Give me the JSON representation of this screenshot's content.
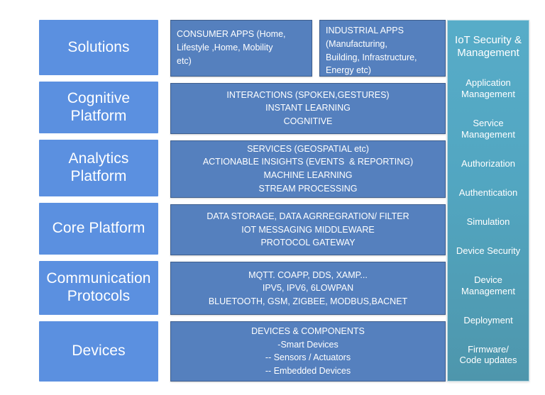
{
  "layers": [
    {
      "label": "Solutions"
    },
    {
      "label_line1": "Cognitive",
      "label_line2": "Platform"
    },
    {
      "label_line1": "Analytics",
      "label_line2": "Platform"
    },
    {
      "label": "Core Platform"
    },
    {
      "label_line1": "Communication",
      "label_line2": "Protocols"
    },
    {
      "label": "Devices"
    }
  ],
  "left_labels": {
    "solutions": "Solutions",
    "cognitive_1": "Cognitive",
    "cognitive_2": "Platform",
    "analytics_1": "Analytics",
    "analytics_2": "Platform",
    "core": "Core Platform",
    "comm_1": "Communication",
    "comm_2": "Protocols",
    "devices": "Devices"
  },
  "content": {
    "solutions": {
      "consumer_apps": {
        "line1": "CONSUMER APPS (Home,",
        "line2": "Lifestyle ,Home, Mobility",
        "line3": "etc)"
      },
      "industrial_apps": {
        "line1": "INDUSTRIAL APPS",
        "line2": "(Manufacturing,",
        "line3": "Building, Infrastructure,",
        "line4": "Energy etc)"
      }
    },
    "cognitive_platform": {
      "line1": "INTERACTIONS (SPOKEN,GESTURES)",
      "line2": "INSTANT LEARNING",
      "line3": "COGNITIVE"
    },
    "analytics_platform": {
      "line1": "SERVICES (GEOSPATIAL etc)",
      "line2": "ACTIONABLE INSIGHTS (EVENTS  & REPORTING)",
      "line3": "MACHINE LEARNING",
      "line4": "STREAM PROCESSING"
    },
    "core_platform": {
      "line1": "DATA STORAGE, DATA AGRREGRATION/ FILTER",
      "line2": "IOT MESSAGING MIDDLEWARE",
      "line3": "PROTOCOL GATEWAY"
    },
    "communication_protocols": {
      "line1": "MQTT. COAPP, DDS, XAMP...",
      "line2": "IPV5, IPV6, 6LOWPAN",
      "line3": "BLUETOOTH, GSM, ZIGBEE, MODBUS,BACNET"
    },
    "devices": {
      "line1": "DEVICES & COMPONENTS",
      "line2": "-Smart Devices",
      "line3": "-- Sensors / Actuators",
      "line4": "-- Embedded Devices"
    }
  },
  "security_column": {
    "title_line1": "IoT Security &",
    "title_line2": "Management",
    "items": [
      {
        "line1": "Application",
        "line2": "Management"
      },
      {
        "line1": "Service",
        "line2": "Management"
      },
      {
        "line1": "Authorization",
        "line2": ""
      },
      {
        "line1": "Authentication",
        "line2": ""
      },
      {
        "line1": "Simulation",
        "line2": ""
      },
      {
        "line1": "Device Security",
        "line2": ""
      },
      {
        "line1": "Device",
        "line2": "Management"
      },
      {
        "line1": "Deployment",
        "line2": ""
      },
      {
        "line1": "Firmware/",
        "line2": "Code updates"
      }
    ]
  },
  "colors": {
    "layer_label_bg": "#5B90E0",
    "content_box_bg": "#5580BE",
    "security_col_top": "#57ACC8",
    "security_col_bottom": "#4E96AC",
    "text": "#FFFFFF",
    "page_bg": "#FFFFFF"
  }
}
